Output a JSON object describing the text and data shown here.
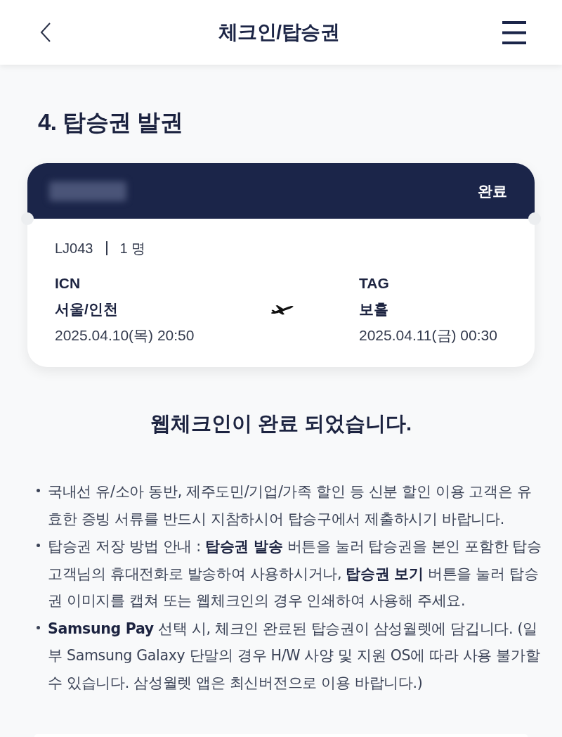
{
  "header": {
    "title": "체크인/탑승권"
  },
  "section_title": "4. 탑승권 발권",
  "ticket": {
    "status": "완료",
    "flight": "LJ043",
    "passengers": "1 명",
    "departure": {
      "code": "ICN",
      "city": "서울/인천",
      "datetime": "2025.04.10(목) 20:50"
    },
    "arrival": {
      "code": "TAG",
      "city": "보홀",
      "datetime": "2025.04.11(금) 00:30"
    }
  },
  "message": "웹체크인이 완료 되었습니다.",
  "notices": [
    "국내선 유/소아 동반, 제주도민/기업/가족 할인 등 신분 할인 이용 고객은 유효한 증빙 서류를 반드시 지참하시어 탑승구에서 제출하시기 바랍니다.",
    "탑승권 저장 방법 안내 : **탑승권 발송** 버튼을 눌러 탑승권을 본인 포함한 탑승 고객님의 휴대전화로 발송하여 사용하시거나, **탑승권 보기** 버튼을 눌러 탑승권 이미지를 캡쳐 또는 웹체크인의 경우 인쇄하여 사용해 주세요.",
    "**Samsung Pay** 선택 시, 체크인 완료된 탑승권이 삼성월렛에 담깁니다. (일부 Samsung Galaxy 단말의 경우 H/W 사양 및 지원 OS에 따라 사용 불가할 수 있습니다. 삼성월렛 앱은 최신버전으로 이용 바랍니다.)"
  ]
}
